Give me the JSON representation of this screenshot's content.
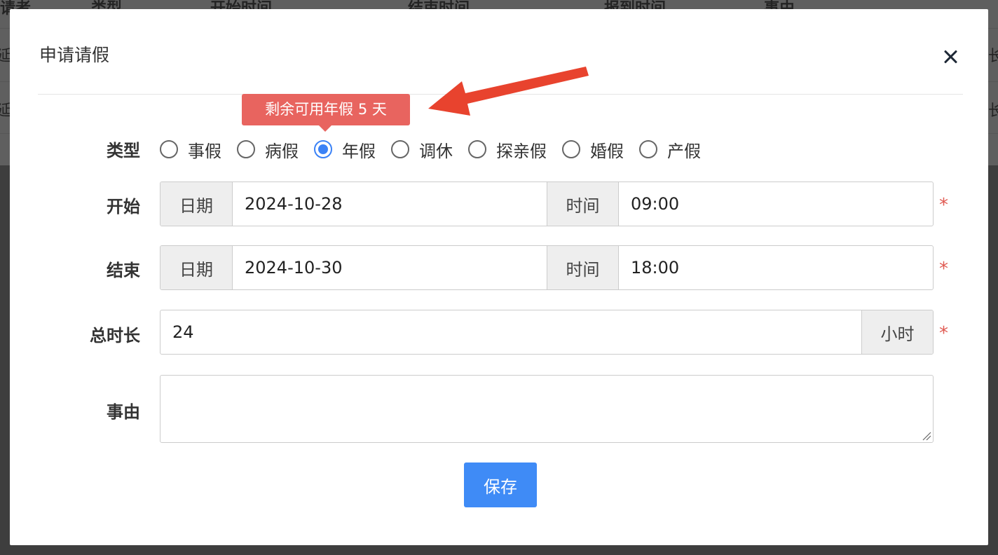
{
  "background": {
    "headers": [
      "请者",
      "类型",
      "开始时间",
      "结束时间",
      "报到时间",
      "事由"
    ],
    "row_fragments": [
      "延",
      "长",
      "延",
      "长"
    ]
  },
  "modal": {
    "title": "申请请假",
    "tooltip": "剩余可用年假 5 天",
    "type_label": "类型",
    "leave_types": [
      {
        "label": "事假",
        "checked": false
      },
      {
        "label": "病假",
        "checked": false
      },
      {
        "label": "年假",
        "checked": true
      },
      {
        "label": "调休",
        "checked": false
      },
      {
        "label": "探亲假",
        "checked": false
      },
      {
        "label": "婚假",
        "checked": false
      },
      {
        "label": "产假",
        "checked": false
      }
    ],
    "start": {
      "label": "开始",
      "date_addon": "日期",
      "date": "2024-10-28",
      "time_addon": "时间",
      "time": "09:00"
    },
    "end": {
      "label": "结束",
      "date_addon": "日期",
      "date": "2024-10-30",
      "time_addon": "时间",
      "time": "18:00"
    },
    "duration": {
      "label": "总时长",
      "value": "24",
      "unit": "小时"
    },
    "reason": {
      "label": "事由",
      "value": ""
    },
    "required_mark": "*",
    "save_label": "保存"
  },
  "colors": {
    "primary": "#3f8bf6",
    "tooltip_bg": "#e8645f",
    "arrow": "#e8432e",
    "required": "#e05a52"
  }
}
